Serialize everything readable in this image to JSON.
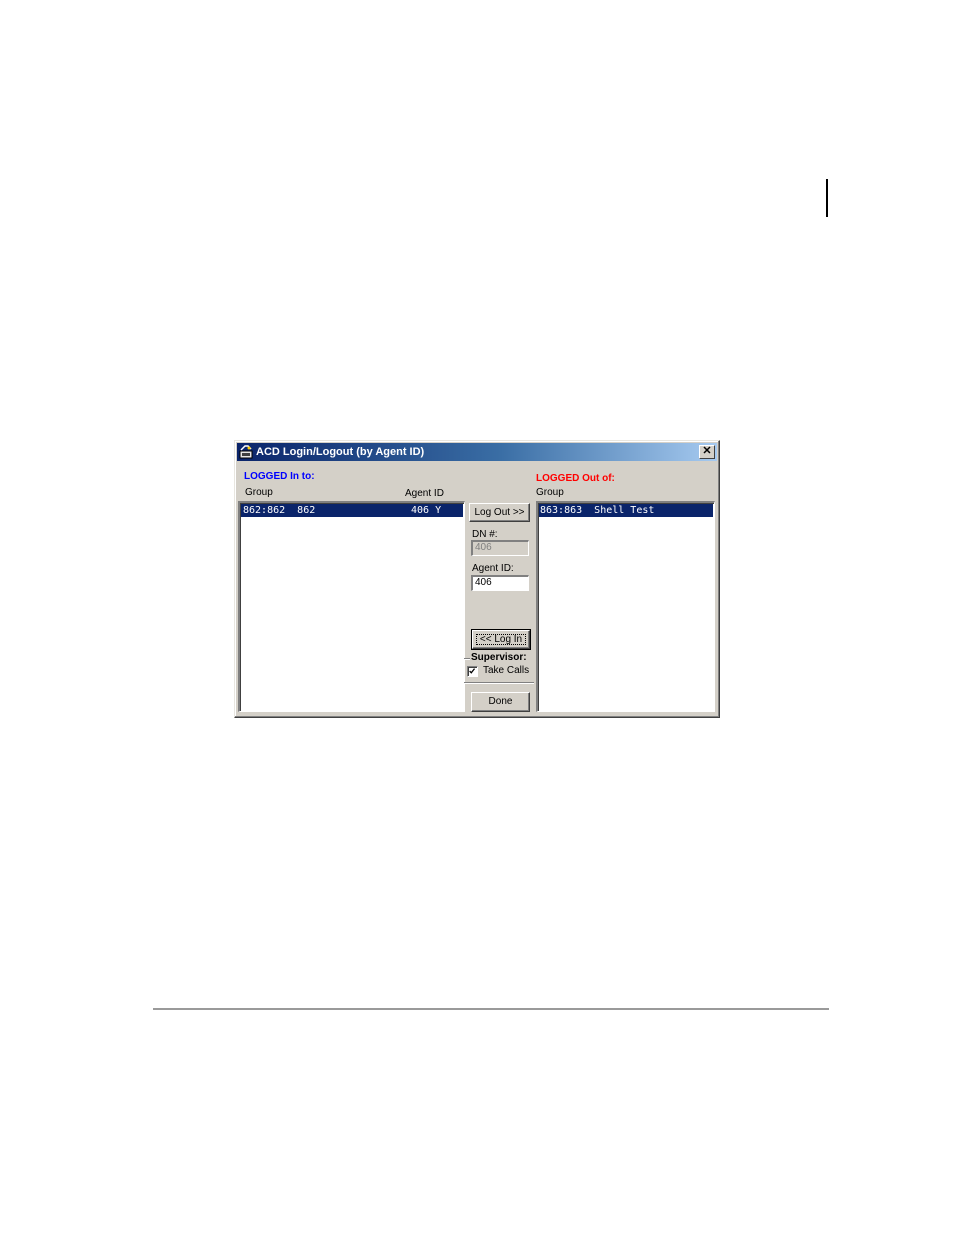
{
  "dialog": {
    "title": "ACD Login/Logout (by Agent ID)",
    "close_glyph": "✕",
    "logged_in": {
      "heading": "LOGGED In to:",
      "heading_color": "#0000ff",
      "col_group": "Group",
      "col_agent_id": "Agent ID",
      "rows": [
        {
          "group": "862:862  862",
          "agent": "406 Y"
        }
      ]
    },
    "logged_out": {
      "heading": "LOGGED Out of:",
      "heading_color": "#ff0000",
      "col_group": "Group",
      "rows": [
        {
          "group": "863:863  Shell Test"
        }
      ]
    },
    "logout_button": "Log Out >>",
    "dn_label": "DN #:",
    "dn_value": "406",
    "agent_id_label": "Agent ID:",
    "agent_id_value": "406",
    "login_button": "<< Log In",
    "supervisor_label": "Supervisor:",
    "take_calls_label": "Take Calls",
    "take_calls_checked": true,
    "done_button": "Done"
  }
}
